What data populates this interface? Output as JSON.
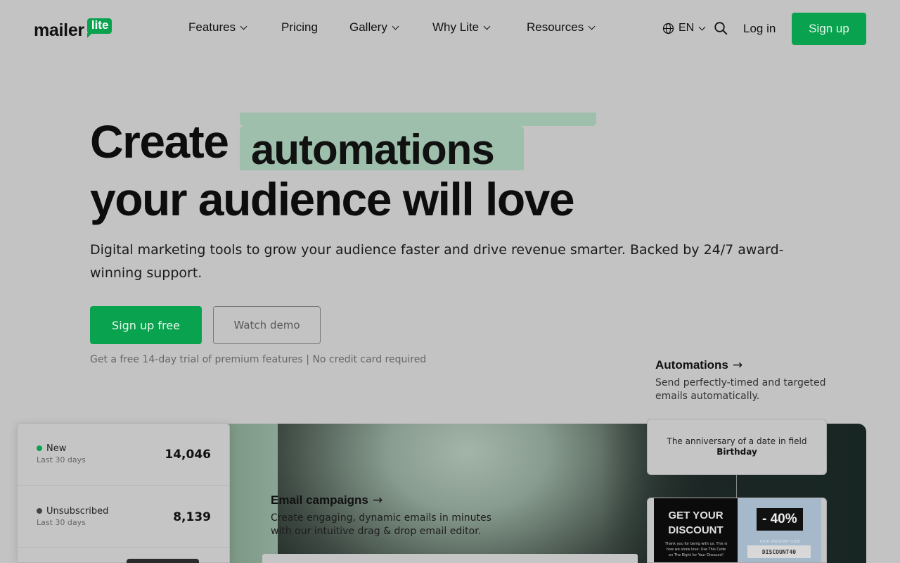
{
  "nav": {
    "logo_text": "mailer",
    "logo_badge": "lite",
    "items": [
      {
        "label": "Features",
        "has_dropdown": true
      },
      {
        "label": "Pricing",
        "has_dropdown": false
      },
      {
        "label": "Gallery",
        "has_dropdown": true
      },
      {
        "label": "Why Lite",
        "has_dropdown": true
      },
      {
        "label": "Resources",
        "has_dropdown": true
      }
    ],
    "language": "EN",
    "login_label": "Log in",
    "signup_label": "Sign up"
  },
  "hero": {
    "title_prefix": "Create",
    "rotating_word": "automations",
    "title_line2": "your audience will love",
    "subtitle": "Digital marketing tools to grow your audience faster and drive revenue smarter. Backed by 24/7 award-winning support.",
    "cta_primary": "Sign up free",
    "cta_secondary": "Watch demo",
    "trial_note": "Get a free 14-day trial of premium features | No credit card required"
  },
  "features": {
    "campaigns": {
      "title": "Email campaigns",
      "arrow": "→",
      "description": "Create engaging, dynamic emails in minutes with our intuitive drag & drop email editor."
    },
    "automations": {
      "title": "Automations",
      "arrow": "→",
      "description": "Send perfectly-timed and targeted emails automatically.",
      "trigger_text": "The anniversary of a date in field",
      "trigger_field": "Birthday"
    }
  },
  "stats": [
    {
      "label": "New",
      "period": "Last 30 days",
      "value": "14,046",
      "dot_color": "#09a24e"
    },
    {
      "label": "Unsubscribed",
      "period": "Last 30 days",
      "value": "8,139",
      "dot_color": "#444444"
    }
  ],
  "email_preview": {
    "headline": "GET YOUR DISCOUNT",
    "fine_print": "Thank you for being with us. This is how we show love: Use This Code on The Right for Your Discount!",
    "discount": "- 40%",
    "code_caption": "YOUR DISCOUNT CODE",
    "code": "DISCOUNT40"
  },
  "colors": {
    "brand_green": "#09a24e",
    "highlight": "#9dbfac",
    "background": "#c3c3c3"
  }
}
